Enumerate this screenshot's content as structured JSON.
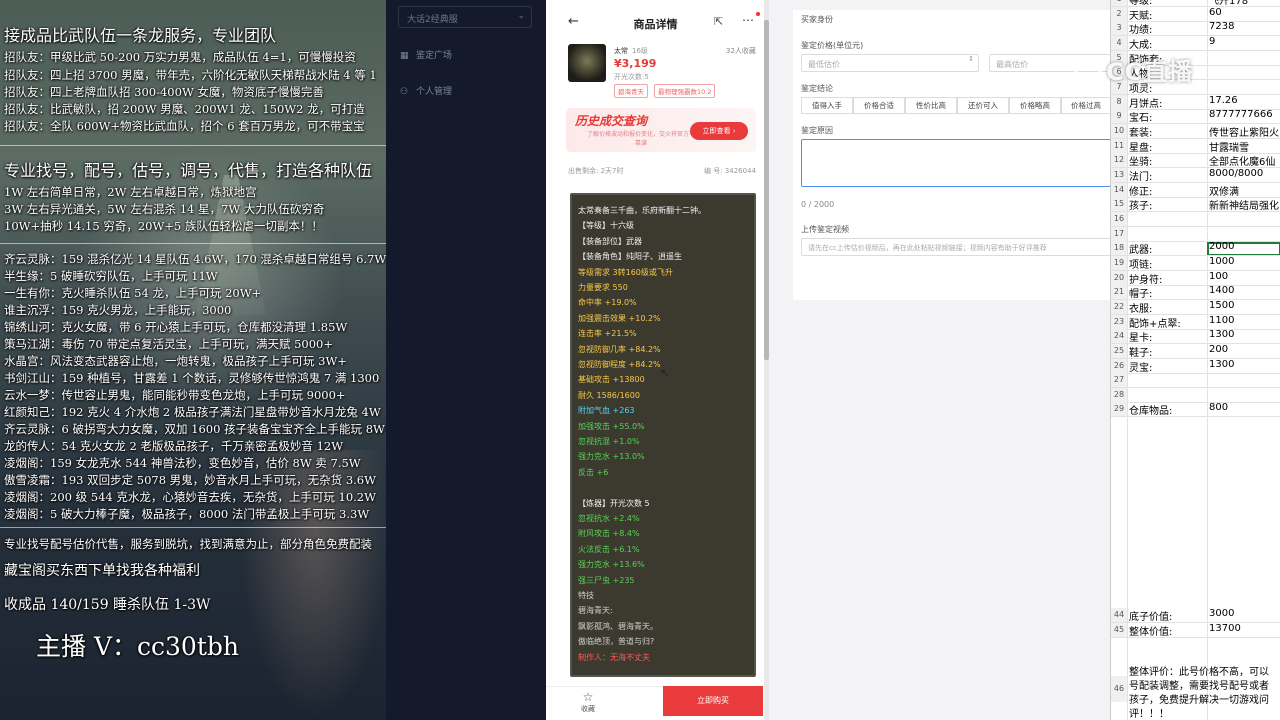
{
  "stream": {
    "header": "接成品比武队伍一条龙服务，专业团队",
    "recruit": [
      "招队友：甲级比武 50-200 万实力男鬼，成品队伍 4=1，可慢慢投资",
      "招队友：四上招 3700 男魔，带年売，六阶化无敏队天梯帮战水陆 4 等 1",
      "招队友：四上老牌血队招 300-400W 女魔，物资底子慢慢完善",
      "招队友：比武敏队，招 200W 男魔、200W1 龙、150W2 龙，可打造",
      "招队友：全队 600W+物资比武血队，招个 6 套百万男龙，可不带宝宝"
    ],
    "service_title": "专业找号，配号，估号，调号，代售，打造各种队伍",
    "service_lines": [
      "1W 左右简单日常，2W 左右卓越日常，炼狱地宫",
      "3W 左右异光通关，5W 左右混杀 14 星，7W 大力队伍砍穷奇",
      "10W+抽秒 14.15 穷奇，20W+5 族队伍轻松虐一切副本！！"
    ],
    "listings": [
      "齐云灵脉：159 混杀亿光 14 星队伍 4.6W，170 混杀卓越日常组号 6.7W",
      "半生缘：5 破睡砍穷队伍，上手可玩 11W",
      "一生有你：克火睡杀队伍 54 龙，上手可玩 20W+",
      "谁主沉浮：159 克火男龙，上手能玩，3000",
      "锦绣山河：克火女魔，带 6 开心猿上手可玩，仓库都没清理 1.85W",
      "策马江湖：毒伤 70 带定点复活灵宝，上手可玩，满天赋 5000+",
      "水晶宫：风法变态武器容止炮，一炮转鬼，极品孩子上手可玩 3W+",
      "书剑江山：159 种植号，甘露差 1 个数话，灵修够传世惊鸿鬼 7 满 1300",
      "云水一梦：传世容止男鬼，能同能秒带变色龙炮，上手可玩 9000+",
      "红颜知己：192 克火 4 介水炮 2 极品孩子满法门星盘带妙音水月龙兔 4W",
      "齐云灵脉：6 破拐弯大力女魔，双加 1600 孩子装备宝宝齐全上手能玩 8W+",
      "龙的传人：54 克火女龙 2 老版极品孩子，千万亲密孟极妙音 12W",
      "凌烟阁：159 女龙克水 544 神兽法秒，变色妙音，估价 8W 卖 7.5W",
      "傲雪凌霜：193 双回步定 5078 男鬼，妙音水月上手可玩，无杂货 3.6W",
      "凌烟阁：200 级 544 克水龙，心猿妙音去疾，无杂货，上手可玩 10.2W",
      "凌烟阁：5 破大力棒子魔，极品孩子，8000 法门带孟极上手可玩 3.3W"
    ],
    "footer1": "专业找号配号估价代售，服务到脱坑，找到满意为止，部分角色免费配装",
    "footer2": "藏宝阁买东西下单找我各种福利",
    "footer3": "收成品 140/159 睡杀队伍 1-3W",
    "anchor": "主播 V：cc30tbh"
  },
  "nav": {
    "select_value": "大话2经典服",
    "items": [
      {
        "icon": "cube-icon",
        "label": "鉴定广场"
      },
      {
        "icon": "user-icon",
        "label": "个人管理"
      }
    ]
  },
  "phone": {
    "title": "商品详情",
    "item_name": "太常",
    "item_level": "16级",
    "favorites": "32人收藏",
    "price": "¥3,199",
    "status": "开光次数:5",
    "tags": [
      "碧海青天",
      "最物理强霸数10.2"
    ],
    "banner_title": "历史成交查询",
    "banner_sub": "了解价格波动和报价变化，交火将官方不靠谱",
    "banner_btn": "立即查看 ›",
    "sale_left": "出售剩余: 2天7时",
    "serial": "编 号: 3426044",
    "detail_lines": [
      {
        "t": "太常奏备三千曲，乐府新翻十二钟。",
        "c": "#f0f0f0"
      },
      {
        "t": "【等级】十六级",
        "c": "#f0f0f0"
      },
      {
        "t": "【装备部位】武器",
        "c": "#f0f0f0"
      },
      {
        "t": "【装备角色】纯阳子、逍遥生",
        "c": "#f0f0f0"
      },
      {
        "t": "等级需求 3转160级或飞升",
        "c": "#f6c94a"
      },
      {
        "t": "力量要求 550",
        "c": "#f6c94a"
      },
      {
        "t": "命中率 +19.0%",
        "c": "#f6c94a"
      },
      {
        "t": "加强震击效果 +10.2%",
        "c": "#f6c94a"
      },
      {
        "t": "连击率 +21.5%",
        "c": "#f6c94a"
      },
      {
        "t": "忽视防御几率 +84.2%",
        "c": "#f6c94a"
      },
      {
        "t": "忽视防御程度 +84.2%",
        "c": "#f6c94a"
      },
      {
        "t": "基础攻击 +13800",
        "c": "#f6c94a"
      },
      {
        "t": "耐久 1586/1600",
        "c": "#f6c94a"
      },
      {
        "t": "附加气血 +263",
        "c": "#4fd3f0"
      },
      {
        "t": "加强攻击 +55.0%",
        "c": "#56d356"
      },
      {
        "t": "忽视抗混 +1.0%",
        "c": "#56d356"
      },
      {
        "t": "强力克水 +13.0%",
        "c": "#56d356"
      },
      {
        "t": "反击 +6",
        "c": "#56d356"
      },
      {
        "t": "",
        "c": "#f0f0f0"
      },
      {
        "t": "【炼器】开光次数 5",
        "c": "#f0f0f0"
      },
      {
        "t": "忽视抗水 +2.4%",
        "c": "#56d356"
      },
      {
        "t": "附风攻击 +8.4%",
        "c": "#56d356"
      },
      {
        "t": "火法反击 +6.1%",
        "c": "#56d356"
      },
      {
        "t": "强力克水 +13.6%",
        "c": "#56d356"
      },
      {
        "t": "强三尸虫 +235",
        "c": "#56d356"
      },
      {
        "t": "特技",
        "c": "#cfcfcf"
      },
      {
        "t": "碧海青天:",
        "c": "#cfcfcf"
      },
      {
        "t": "飘影孤鸿、碧海青天。",
        "c": "#cfcfcf"
      },
      {
        "t": "傲临绝顶，普道与归?",
        "c": "#cfcfcf"
      },
      {
        "t": "制作人：无海不丈夫",
        "c": "#ff5a5a"
      }
    ],
    "fav_label": "收藏",
    "buy_label": "立即购买"
  },
  "form": {
    "section": "买家身份",
    "price_label": "鉴定价格(单位元)",
    "min_placeholder": "最低估价",
    "max_placeholder": "最高估价",
    "result_label": "鉴定结论",
    "chips": [
      "值得入手",
      "价格合适",
      "性价比高",
      "还价可入",
      "价格略高",
      "价格过高"
    ],
    "reason_label": "鉴定原因",
    "counter": "0 / 2000",
    "video_label": "上传鉴定视频",
    "video_placeholder": "请先在cc上传估价视频后，再在此处粘贴视频链接；视频内容有助于好评推荐"
  },
  "sheet": {
    "rows": [
      {
        "n": "1",
        "a": "等级:",
        "b": "飞升178"
      },
      {
        "n": "2",
        "a": "天赋:",
        "b": "60"
      },
      {
        "n": "3",
        "a": "功绩:",
        "b": "7238"
      },
      {
        "n": "4",
        "a": "大成:",
        "b": "9"
      },
      {
        "n": "5",
        "a": "配饰套:",
        "b": ""
      },
      {
        "n": "6",
        "a": "人物:",
        "b": ""
      },
      {
        "n": "7",
        "a": "项灵:",
        "b": ""
      },
      {
        "n": "8",
        "a": "月饼点:",
        "b": "17.26"
      },
      {
        "n": "9",
        "a": "宝石:",
        "b": "8777777666"
      },
      {
        "n": "10",
        "a": "套装:",
        "b": "传世容止紫阳火"
      },
      {
        "n": "11",
        "a": "星盘:",
        "b": "甘露瑞雪"
      },
      {
        "n": "12",
        "a": "坐骑:",
        "b": "全部点化魔6仙"
      },
      {
        "n": "13",
        "a": "法门:",
        "b": "8000/8000"
      },
      {
        "n": "14",
        "a": "修正:",
        "b": "双修满"
      },
      {
        "n": "15",
        "a": "孩子:",
        "b": "新新神结局强化"
      },
      {
        "n": "16",
        "a": "",
        "b": ""
      },
      {
        "n": "17",
        "a": "",
        "b": ""
      },
      {
        "n": "18",
        "a": "武器:",
        "b": "2000"
      },
      {
        "n": "19",
        "a": "项链:",
        "b": "1000"
      },
      {
        "n": "20",
        "a": "护身符:",
        "b": "100"
      },
      {
        "n": "21",
        "a": "帽子:",
        "b": "1400"
      },
      {
        "n": "22",
        "a": "衣服:",
        "b": "1500"
      },
      {
        "n": "23",
        "a": "配饰+点翠:",
        "b": "1100"
      },
      {
        "n": "24",
        "a": "星卡:",
        "b": "1300"
      },
      {
        "n": "25",
        "a": "鞋子:",
        "b": "200"
      },
      {
        "n": "26",
        "a": "灵宝:",
        "b": "1300"
      },
      {
        "n": "27",
        "a": "",
        "b": ""
      },
      {
        "n": "28",
        "a": "",
        "b": ""
      },
      {
        "n": "29",
        "a": "仓库物品:",
        "b": "800"
      }
    ],
    "bottom_rows": [
      {
        "n": "44",
        "a": "底子价值:",
        "b": "3000"
      },
      {
        "n": "45",
        "a": "整体价值:",
        "b": "13700"
      }
    ],
    "row46": "46",
    "evaluation": [
      "整体评价：此号价格不高，可以",
      "号配装调整，需要找号配号或者",
      "孩子，免费提升解决一切游戏问",
      "评！！！"
    ]
  },
  "watermark": "CC直播"
}
